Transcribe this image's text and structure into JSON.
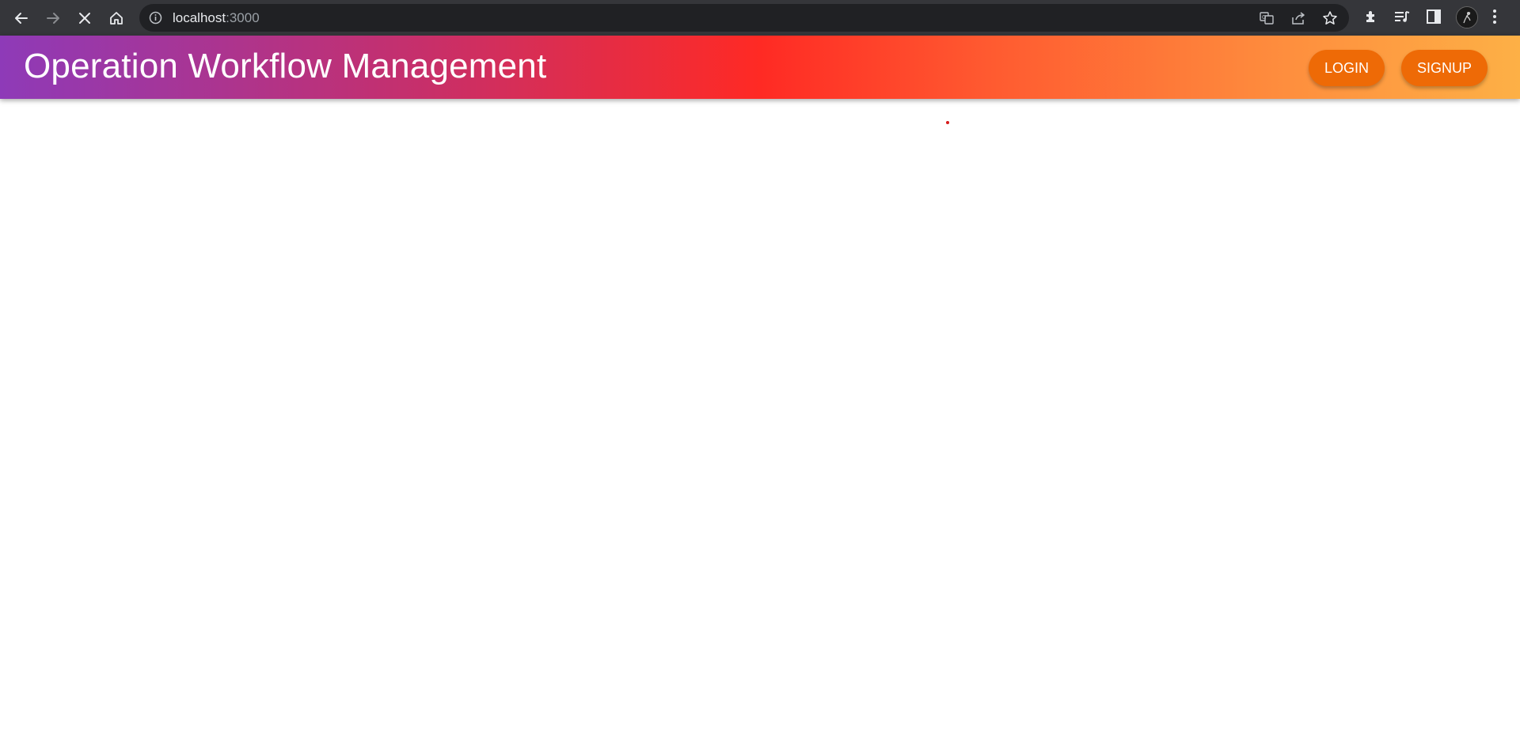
{
  "browser": {
    "url_host": "localhost",
    "url_port": ":3000",
    "icons": [
      "back-arrow-icon",
      "forward-arrow-icon",
      "stop-loading-icon",
      "home-icon",
      "site-info-icon",
      "translate-icon",
      "share-icon",
      "bookmark-star-icon",
      "extensions-icon",
      "reading-list-icon",
      "side-panel-icon",
      "profile-avatar",
      "more-menu-icon"
    ]
  },
  "header": {
    "title": "Operation Workflow Management",
    "login_label": "LOGIN",
    "signup_label": "SIGNUP",
    "gradient_colors": [
      "#8e3ab8",
      "#c72f6a",
      "#ff2a24",
      "#ff5a30",
      "#fe8f3e",
      "#fdb046"
    ],
    "button_color": "#ee6a06"
  }
}
